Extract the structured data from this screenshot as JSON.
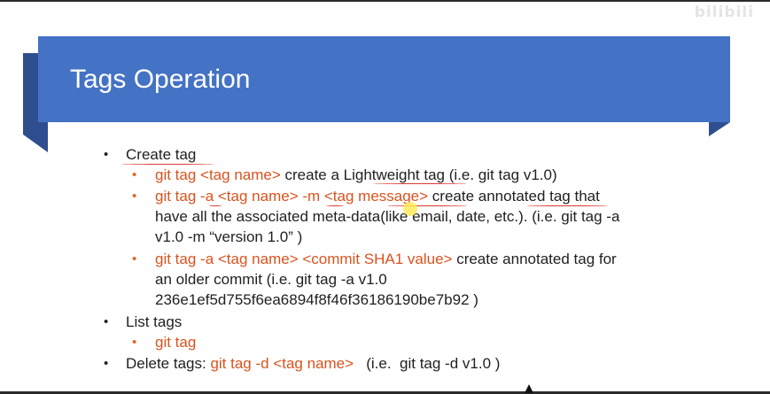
{
  "watermark": "bilibili",
  "slide": {
    "title": "Tags Operation",
    "create": {
      "label": "Create tag",
      "items": [
        {
          "cmd": "git tag <tag name>",
          "rest": " create a Lightweight tag (i.e. git tag v1.0)"
        },
        {
          "cmd_a": "git tag -a <tag name> -m <tag message>",
          "rest_line1": " create annotated tag that",
          "line2": "have all the associated meta-data(like email, date, etc.). (i.e. git tag -a",
          "line3": "v1.0 -m “version 1.0” )"
        },
        {
          "cmd": "git tag -a <tag name> <commit SHA1 value>",
          "rest_line1": " create annotated tag for",
          "line2": "an older commit (i.e. git tag -a v1.0",
          "line3": "236e1ef5d755f6ea6894f8f46f36186190be7b92 )"
        }
      ]
    },
    "list": {
      "label": "List tags",
      "cmd": "git tag"
    },
    "delete": {
      "label": "Delete tags: ",
      "cmd": "git tag -d <tag name>",
      "rest": "   (i.e.  git tag -d v1.0 )"
    }
  },
  "colors": {
    "banner": "#4472c4",
    "banner_shadow": "#2e4e8f",
    "command": "#d9531e",
    "annotation": "#d63a2e"
  }
}
